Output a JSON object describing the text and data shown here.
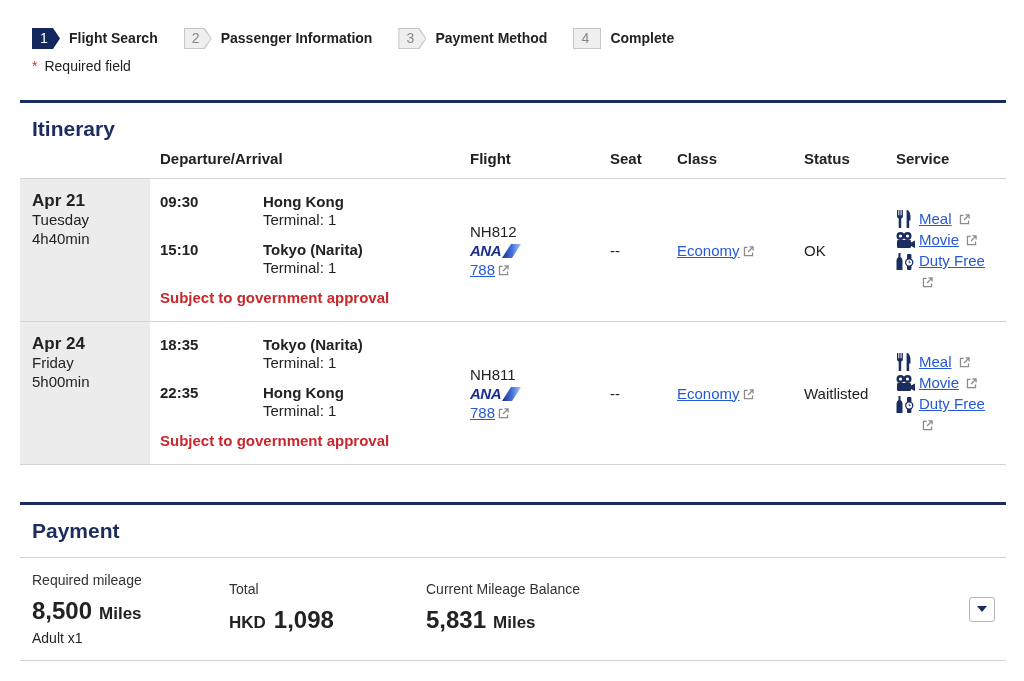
{
  "progress_steps": [
    {
      "number": "1",
      "label": "Flight Search",
      "selected": true
    },
    {
      "number": "2",
      "label": "Passenger Information",
      "selected": false
    },
    {
      "number": "3",
      "label": "Payment Method",
      "selected": false
    },
    {
      "number": "4",
      "label": "Complete",
      "selected": false
    }
  ],
  "required_note": {
    "marker": "*",
    "text": "Required field"
  },
  "itinerary": {
    "title": "Itinerary",
    "columns": [
      "Departure/Arrival",
      "Flight",
      "Seat",
      "Class",
      "Status",
      "Service"
    ],
    "rows": [
      {
        "date": "Apr 21",
        "weekday": "Tuesday",
        "duration": "4h40min",
        "departure": {
          "time": "09:30",
          "city": "Hong Kong",
          "terminal": "Terminal: 1"
        },
        "arrival": {
          "time": "15:10",
          "city": "Tokyo (Narita)",
          "terminal": "Terminal: 1"
        },
        "notice": "Subject to government approval",
        "flight_number": "NH812",
        "airline_logo": "ANA",
        "aircraft": "788",
        "seat": "--",
        "class": "Economy",
        "status": "OK",
        "services": [
          {
            "kind": "meal",
            "label": "Meal"
          },
          {
            "kind": "movie",
            "label": "Movie"
          },
          {
            "kind": "duty_free",
            "label": "Duty Free"
          }
        ]
      },
      {
        "date": "Apr 24",
        "weekday": "Friday",
        "duration": "5h00min",
        "departure": {
          "time": "18:35",
          "city": "Tokyo (Narita)",
          "terminal": "Terminal: 1"
        },
        "arrival": {
          "time": "22:35",
          "city": "Hong Kong",
          "terminal": "Terminal: 1"
        },
        "notice": "Subject to government approval",
        "flight_number": "NH811",
        "airline_logo": "ANA",
        "aircraft": "788",
        "seat": "--",
        "class": "Economy",
        "status": "Waitlisted",
        "services": [
          {
            "kind": "meal",
            "label": "Meal"
          },
          {
            "kind": "movie",
            "label": "Movie"
          },
          {
            "kind": "duty_free",
            "label": "Duty Free"
          }
        ]
      }
    ]
  },
  "payment": {
    "title": "Payment",
    "required_mileage": {
      "label": "Required mileage",
      "amount": "8,500",
      "unit": "Miles",
      "note": "Adult x1"
    },
    "total": {
      "label": "Total",
      "currency": "HKD",
      "amount": "1,098"
    },
    "balance": {
      "label": "Current Mileage Balance",
      "amount": "5,831",
      "unit": "Miles"
    }
  }
}
